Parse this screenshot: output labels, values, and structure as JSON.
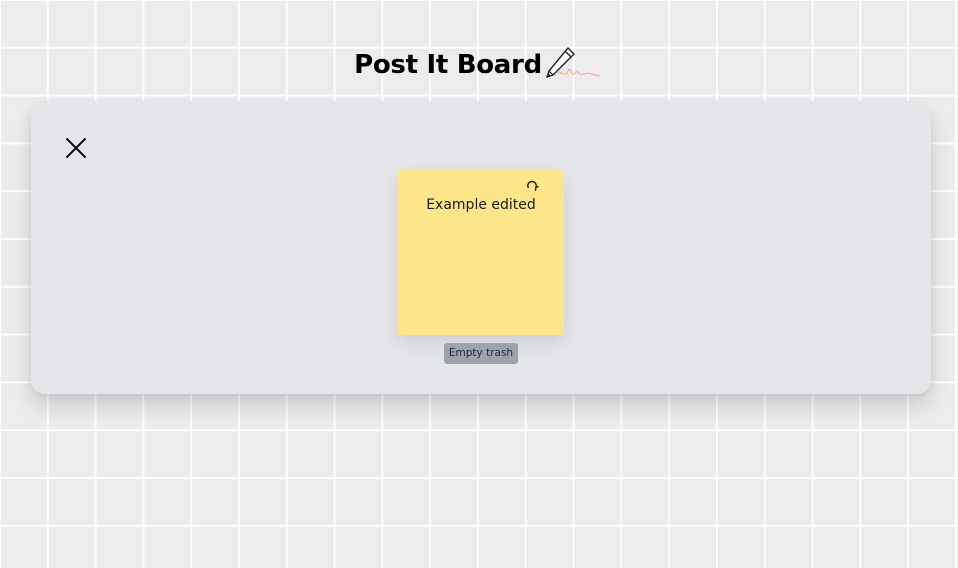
{
  "header": {
    "title": "Post It Board",
    "icon": "pencil-icon"
  },
  "trash": {
    "close_icon": "close-icon",
    "notes": [
      {
        "text": "Example edited",
        "color": "#fde68a",
        "action_icon": "restore-icon"
      }
    ],
    "empty_trash_label": "Empty trash"
  },
  "colors": {
    "board_background": "#ececec",
    "grid_lines": "#ffffff",
    "panel_background": "#e5e6e9",
    "note_yellow": "#fde68a",
    "button_gray": "#9ca3af"
  }
}
